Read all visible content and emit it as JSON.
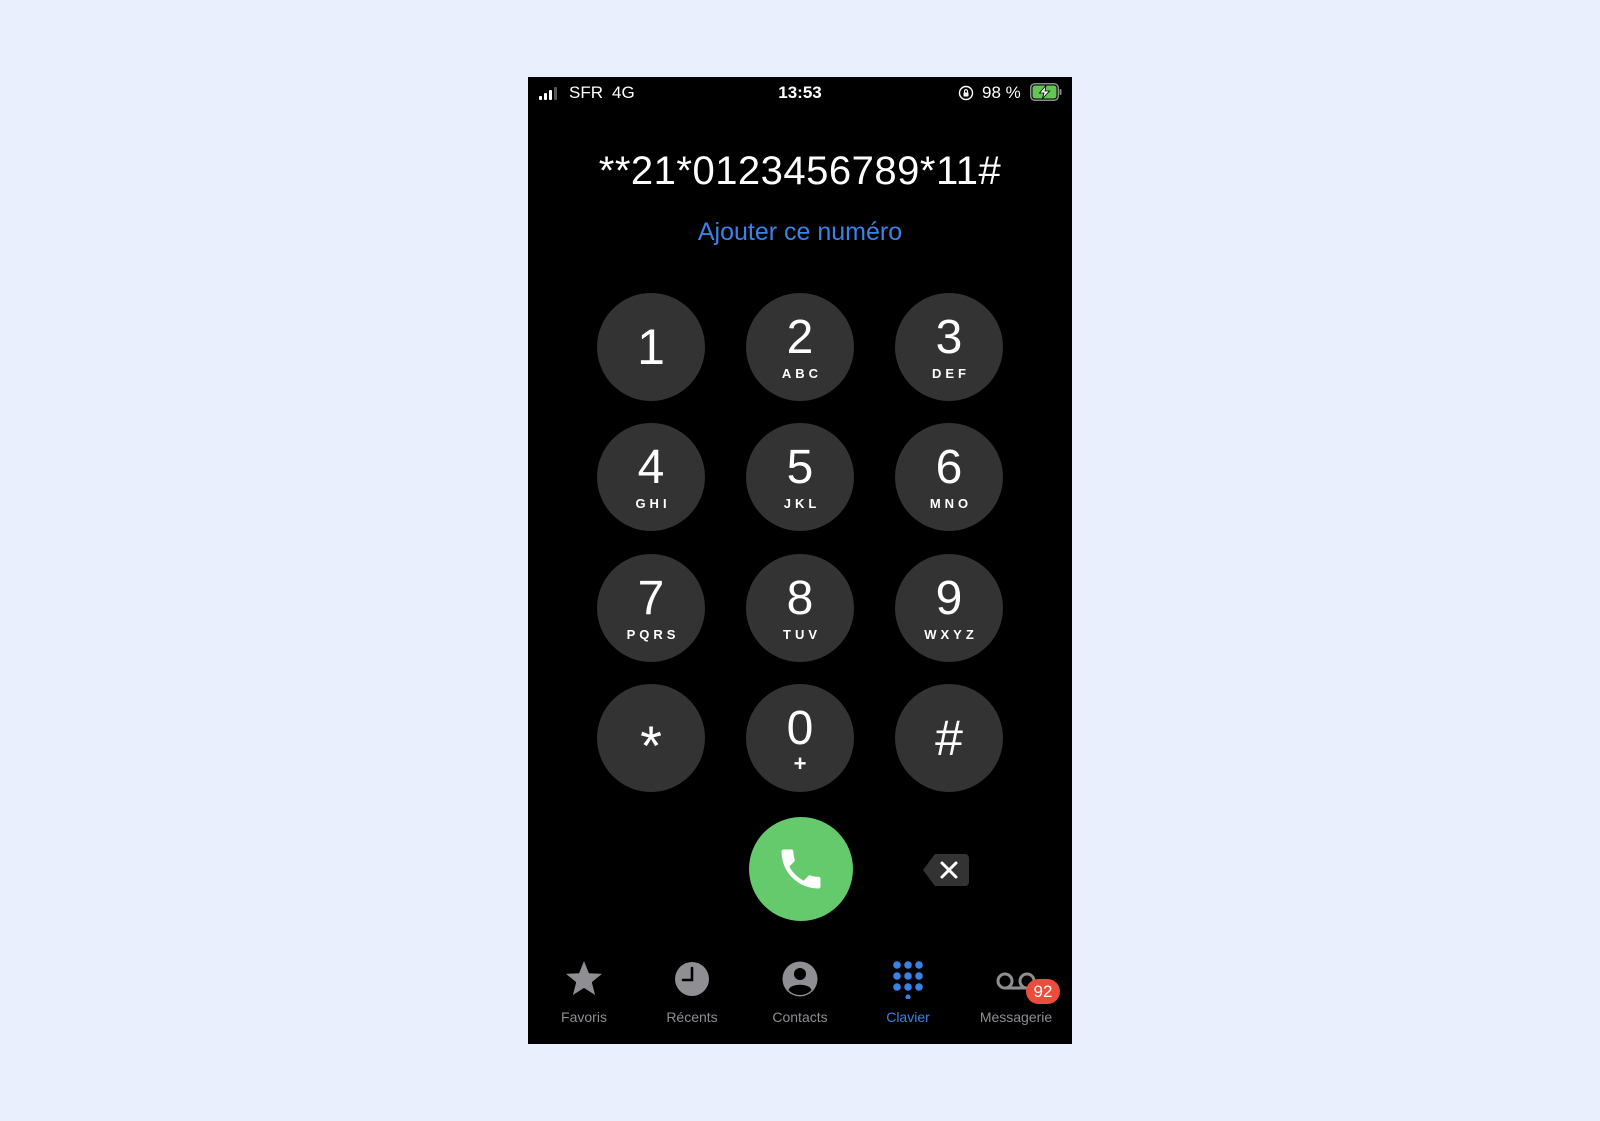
{
  "status_bar": {
    "carrier": "SFR",
    "network": "4G",
    "time": "13:53",
    "battery_percent": "98 %",
    "battery_level": 0.98,
    "charging": true
  },
  "dialer": {
    "number": "**21*0123456789*11#",
    "add_number_label": "Ajouter ce numéro",
    "keys": [
      {
        "digit": "1",
        "letters": ""
      },
      {
        "digit": "2",
        "letters": "ABC"
      },
      {
        "digit": "3",
        "letters": "DEF"
      },
      {
        "digit": "4",
        "letters": "GHI"
      },
      {
        "digit": "5",
        "letters": "JKL"
      },
      {
        "digit": "6",
        "letters": "MNO"
      },
      {
        "digit": "7",
        "letters": "PQRS"
      },
      {
        "digit": "8",
        "letters": "TUV"
      },
      {
        "digit": "9",
        "letters": "WXYZ"
      },
      {
        "digit": "*",
        "letters": ""
      },
      {
        "digit": "0",
        "letters": "+"
      },
      {
        "digit": "#",
        "letters": ""
      }
    ],
    "call_icon": "phone-icon",
    "delete_icon": "backspace-icon"
  },
  "tab_bar": {
    "tabs": [
      {
        "label": "Favoris",
        "icon": "star-icon"
      },
      {
        "label": "Récents",
        "icon": "clock-icon"
      },
      {
        "label": "Contacts",
        "icon": "contact-icon"
      },
      {
        "label": "Clavier",
        "icon": "keypad-icon",
        "active": true
      },
      {
        "label": "Messagerie",
        "icon": "voicemail-icon"
      }
    ],
    "voicemail_badge": "92"
  },
  "colors": {
    "page_background": "#e9effd",
    "accent": "#3b82e6",
    "call_green": "#65ca6c",
    "key_gray": "#333333",
    "badge_red": "#eb4d3d"
  }
}
